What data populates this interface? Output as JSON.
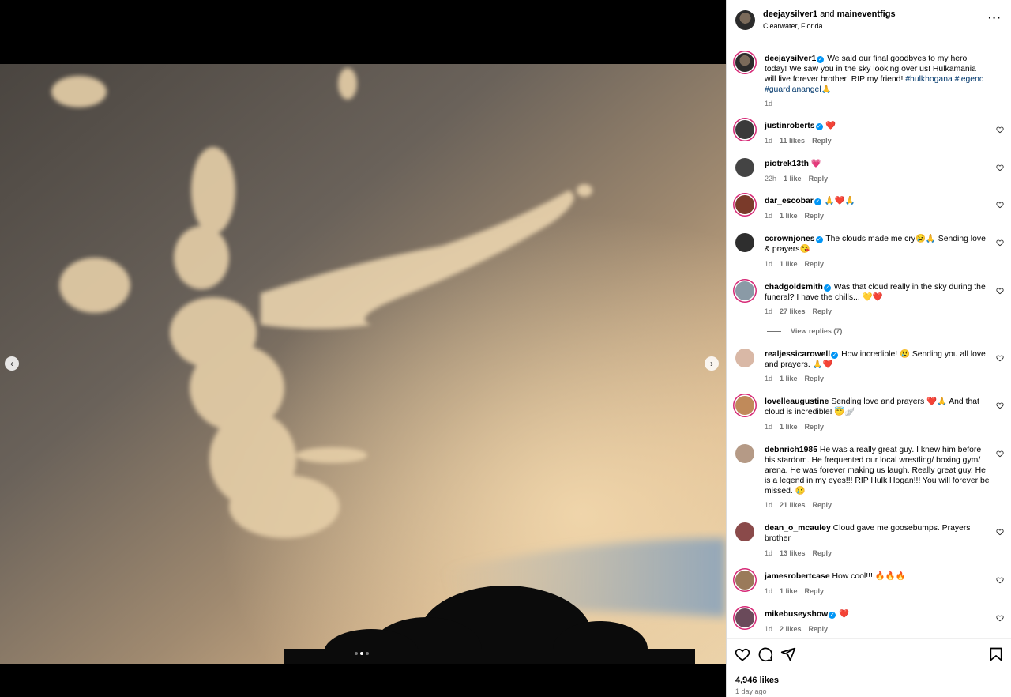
{
  "header": {
    "user1": "deejaysilver1",
    "joiner": "and",
    "user2": "maineventfigs",
    "location": "Clearwater, Florida",
    "more_icon": "more-horizontal-icon"
  },
  "media": {
    "carousel_total": 3,
    "carousel_active": 2,
    "prev_icon": "chevron-left-icon",
    "next_icon": "chevron-right-icon"
  },
  "caption": {
    "user": "deejaysilver1",
    "text": "We said our final goodbyes to my hero today! We saw you in the sky looking over us! Hulkamania will live forever brother! RIP my friend!",
    "tags": [
      "#hulkhogana",
      "#legend",
      "#guardianangel"
    ],
    "emoji": "🙏",
    "time": "1d"
  },
  "comments": [
    {
      "user": "justinroberts",
      "verified": true,
      "text": "❤️",
      "time": "1d",
      "likes": "11 likes",
      "reply": "Reply"
    },
    {
      "user": "piotrek13th",
      "verified": false,
      "text": "💗",
      "time": "22h",
      "likes": "1 like",
      "reply": "Reply"
    },
    {
      "user": "dar_escobar",
      "verified": true,
      "text": "🙏❤️🙏",
      "time": "1d",
      "likes": "1 like",
      "reply": "Reply"
    },
    {
      "user": "ccrownjones",
      "verified": true,
      "text": "The clouds made me cry😢🙏 Sending love & prayers😘",
      "time": "1d",
      "likes": "1 like",
      "reply": "Reply"
    },
    {
      "user": "chadgoldsmith",
      "verified": true,
      "text": "Was that cloud really in the sky during the funeral? I have the chills... 💛❤️",
      "time": "1d",
      "likes": "27 likes",
      "reply": "Reply",
      "view_replies": "View replies (7)"
    },
    {
      "user": "realjessicarowell",
      "verified": true,
      "text": "How incredible! 😢 Sending you all love and prayers. 🙏❤️",
      "time": "1d",
      "likes": "1 like",
      "reply": "Reply"
    },
    {
      "user": "lovelleaugustine",
      "verified": false,
      "text": "Sending love and prayers ❤️🙏 And that cloud is incredible! 😇🪽",
      "time": "1d",
      "likes": "1 like",
      "reply": "Reply"
    },
    {
      "user": "debnrich1985",
      "verified": false,
      "text": "He was a really great guy. I knew him before his stardom. He frequented our local wrestling/ boxing gym/ arena. He was forever making us laugh. Really great guy. He is a legend in my eyes!!! RIP Hulk Hogan!!! You will forever be missed. 😢",
      "time": "1d",
      "likes": "21 likes",
      "reply": "Reply"
    },
    {
      "user": "dean_o_mcauley",
      "verified": false,
      "text": "Cloud gave me goosebumps. Prayers brother",
      "time": "1d",
      "likes": "13 likes",
      "reply": "Reply"
    },
    {
      "user": "jamesrobertcase",
      "verified": false,
      "text": "How cool!!! 🔥🔥🔥",
      "time": "1d",
      "likes": "1 like",
      "reply": "Reply"
    },
    {
      "user": "mikebuseyshow",
      "verified": true,
      "text": "❤️",
      "time": "1d",
      "likes": "2 likes",
      "reply": "Reply"
    }
  ],
  "actions": {
    "like_icon": "heart-icon",
    "comment_icon": "comment-icon",
    "share_icon": "send-icon",
    "save_icon": "bookmark-icon",
    "likes": "4,946 likes",
    "time": "1 day ago"
  },
  "colors": {
    "verified": "#0095f6",
    "hashtag": "#00376b",
    "story_ring": "#d62976",
    "muted": "#737373"
  }
}
